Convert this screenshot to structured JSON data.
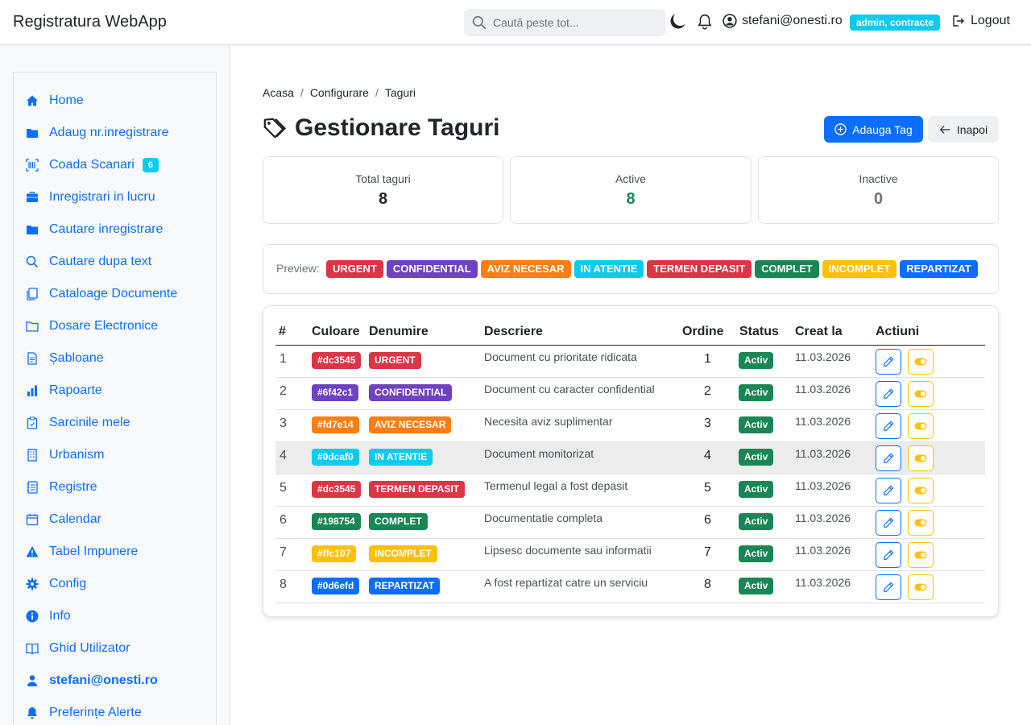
{
  "app": {
    "title": "Registratura WebApp"
  },
  "search": {
    "placeholder": "Caută peste tot..."
  },
  "user": {
    "name": "stefani@onesti.ro",
    "roles": "admin, contracte",
    "logout": "Logout"
  },
  "sidebar": {
    "items": [
      {
        "label": "Home",
        "icon": "home-icon"
      },
      {
        "label": "Adaug nr.inregistrare",
        "icon": "folder-icon"
      },
      {
        "label": "Coada Scanari",
        "icon": "barcode-icon",
        "badge": "6"
      },
      {
        "label": "Inregistrari in lucru",
        "icon": "briefcase-icon"
      },
      {
        "label": "Cautare inregistrare",
        "icon": "folder-icon"
      },
      {
        "label": "Cautare dupa text",
        "icon": "search-icon"
      },
      {
        "label": "Cataloage Documente",
        "icon": "copy-icon"
      },
      {
        "label": "Dosare Electronice",
        "icon": "folder-outline-icon"
      },
      {
        "label": "Șabloane",
        "icon": "document-icon"
      },
      {
        "label": "Rapoarte",
        "icon": "bar-chart-icon"
      },
      {
        "label": "Sarcinile mele",
        "icon": "clipboard-icon"
      },
      {
        "label": "Urbanism",
        "icon": "building-icon"
      },
      {
        "label": "Registre",
        "icon": "journal-icon"
      },
      {
        "label": "Calendar",
        "icon": "calendar-icon"
      },
      {
        "label": "Tabel Impunere",
        "icon": "warning-icon"
      },
      {
        "label": "Config",
        "icon": "gear-icon"
      },
      {
        "label": "Info",
        "icon": "info-icon"
      },
      {
        "label": "Ghid Utilizator",
        "icon": "book-icon"
      },
      {
        "label": "stefani@onesti.ro",
        "icon": "person-icon"
      },
      {
        "label": "Preferințe Alerte",
        "icon": "bell-icon"
      }
    ]
  },
  "breadcrumb": {
    "items": [
      "Acasa",
      "Configurare",
      "Taguri"
    ]
  },
  "page": {
    "title": "Gestionare Taguri",
    "add_button": "Adauga Tag",
    "back_button": "Inapoi"
  },
  "stats": [
    {
      "label": "Total taguri",
      "value": "8",
      "color": "#212529"
    },
    {
      "label": "Active",
      "value": "8",
      "color": "#198754"
    },
    {
      "label": "Inactive",
      "value": "0",
      "color": "#6c757d"
    }
  ],
  "preview": {
    "label": "Preview:",
    "tags": [
      {
        "name": "URGENT",
        "color": "#dc3545"
      },
      {
        "name": "CONFIDENTIAL",
        "color": "#6f42c1"
      },
      {
        "name": "AVIZ NECESAR",
        "color": "#fd7e14"
      },
      {
        "name": "IN ATENTIE",
        "color": "#0dcaf0"
      },
      {
        "name": "TERMEN DEPASIT",
        "color": "#dc3545"
      },
      {
        "name": "COMPLET",
        "color": "#198754"
      },
      {
        "name": "INCOMPLET",
        "color": "#ffc107"
      },
      {
        "name": "REPARTIZAT",
        "color": "#0d6efd"
      }
    ]
  },
  "table": {
    "headers": [
      "#",
      "Culoare",
      "Denumire",
      "Descriere",
      "Ordine",
      "Status",
      "Creat la",
      "Actiuni"
    ],
    "rows": [
      {
        "num": "1",
        "color": "#dc3545",
        "name": "URGENT",
        "description": "Document cu prioritate ridicata",
        "order": "1",
        "status": "Activ",
        "created": "11.03.2026"
      },
      {
        "num": "2",
        "color": "#6f42c1",
        "name": "CONFIDENTIAL",
        "description": "Document cu caracter confidential",
        "order": "2",
        "status": "Activ",
        "created": "11.03.2026"
      },
      {
        "num": "3",
        "color": "#fd7e14",
        "name": "AVIZ NECESAR",
        "description": "Necesita aviz suplimentar",
        "order": "3",
        "status": "Activ",
        "created": "11.03.2026"
      },
      {
        "num": "4",
        "color": "#0dcaf0",
        "name": "IN ATENTIE",
        "description": "Document monitorizat",
        "order": "4",
        "status": "Activ",
        "created": "11.03.2026"
      },
      {
        "num": "5",
        "color": "#dc3545",
        "name": "TERMEN DEPASIT",
        "description": "Termenul legal a fost depasit",
        "order": "5",
        "status": "Activ",
        "created": "11.03.2026"
      },
      {
        "num": "6",
        "color": "#198754",
        "name": "COMPLET",
        "description": "Documentatie completa",
        "order": "6",
        "status": "Activ",
        "created": "11.03.2026"
      },
      {
        "num": "7",
        "color": "#ffc107",
        "name": "INCOMPLET",
        "description": "Lipsesc documente sau informatii",
        "order": "7",
        "status": "Activ",
        "created": "11.03.2026"
      },
      {
        "num": "8",
        "color": "#0d6efd",
        "name": "REPARTIZAT",
        "description": "A fost repartizat catre un serviciu",
        "order": "8",
        "status": "Activ",
        "created": "11.03.2026"
      }
    ]
  }
}
